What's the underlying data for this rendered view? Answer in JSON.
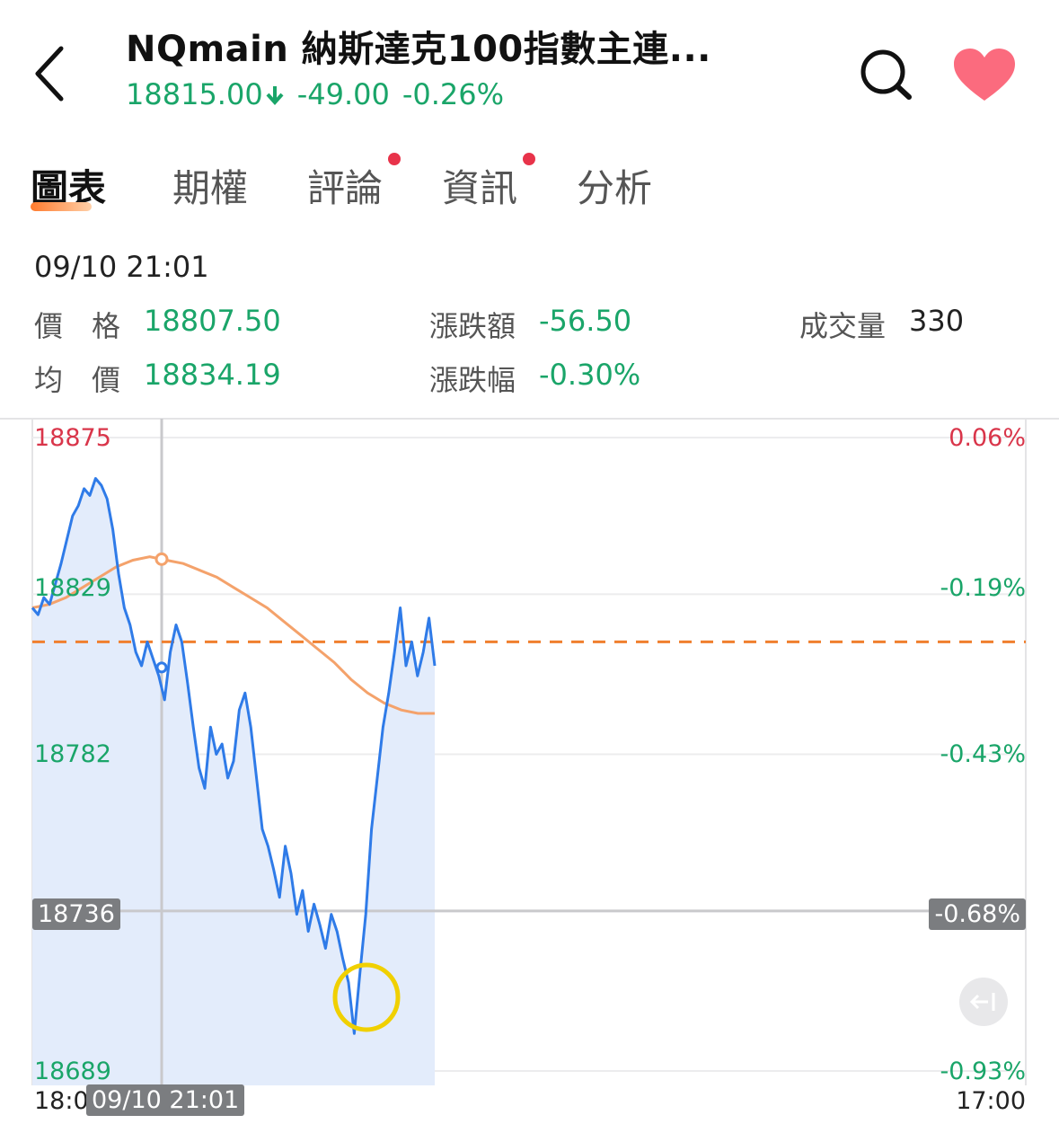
{
  "header": {
    "title": "NQmain  納斯達克100指數主連...",
    "price": "18815.00",
    "change": "-49.00",
    "change_pct": "-0.26%",
    "price_direction": "down",
    "back_icon": "chevron-left-icon",
    "search_icon": "search-icon",
    "favorite_icon": "heart-icon"
  },
  "tabs": [
    {
      "label": "圖表",
      "active": true,
      "has_dot": false
    },
    {
      "label": "期權",
      "active": false,
      "has_dot": false
    },
    {
      "label": "評論",
      "active": false,
      "has_dot": true
    },
    {
      "label": "資訊",
      "active": false,
      "has_dot": true
    },
    {
      "label": "分析",
      "active": false,
      "has_dot": false
    }
  ],
  "info": {
    "time": "09/10 21:01",
    "price_label": "價　格",
    "price_value": "18807.50",
    "avg_label": "均　價",
    "avg_value": "18834.19",
    "change_label": "漲跌額",
    "change_value": "-56.50",
    "change_pct_label": "漲跌幅",
    "change_pct_value": "-0.30%",
    "volume_label": "成交量",
    "volume_value": "330"
  },
  "chart": {
    "y_labels": [
      {
        "text": "18875",
        "color": "red"
      },
      {
        "text": "18829",
        "color": "green"
      },
      {
        "text": "18782",
        "color": "green"
      },
      {
        "text": "18736",
        "color": "tag"
      },
      {
        "text": "18689",
        "color": "green"
      }
    ],
    "pct_labels": [
      {
        "text": "0.06%",
        "color": "red"
      },
      {
        "text": "-0.19%",
        "color": "green"
      },
      {
        "text": "-0.43%",
        "color": "green"
      },
      {
        "text": "-0.68%",
        "color": "tag"
      },
      {
        "text": "-0.93%",
        "color": "green"
      }
    ],
    "x_start": "18:0",
    "x_crosshair_tag": "09/10 21:01",
    "x_end": "17:00",
    "colors": {
      "price_line": "#2f7be8",
      "avg_line": "#f4a26b",
      "ref_line": "#f07f2e",
      "area": "#e3ecfb",
      "highlight": "#f0d000"
    },
    "collapse_icon": "collapse-arrow-icon"
  },
  "chart_data": {
    "type": "line",
    "ylim": [
      18689,
      18875
    ],
    "reference_price": 18815.0,
    "crosshair_time": "09/10 21:01",
    "series": [
      {
        "values": [
          18825,
          18823,
          18828,
          18826,
          18832,
          18838,
          18845,
          18852,
          18855,
          18860,
          18858,
          18863,
          18861,
          18857,
          18848,
          18835,
          18825,
          18820,
          18812,
          18808,
          18815,
          18810,
          18805,
          18798,
          18812,
          18820,
          18815,
          18803,
          18790,
          18778,
          18772,
          18790,
          18782,
          18785,
          18775,
          18780,
          18795,
          18800,
          18790,
          18775,
          18760,
          18755,
          18748,
          18740,
          18755,
          18747,
          18735,
          18742,
          18730,
          18738,
          18732,
          18725,
          18735,
          18730,
          18722,
          18715,
          18700,
          18718,
          18735,
          18760,
          18775,
          18790,
          18800,
          18812,
          18825,
          18808,
          18815,
          18805,
          18812,
          18822,
          18808
        ]
      },
      {
        "values": [
          18825,
          18826,
          18828,
          18831,
          18834,
          18837,
          18839,
          18840,
          18839,
          18838,
          18836,
          18834,
          18831,
          18828,
          18825,
          18821,
          18817,
          18813,
          18809,
          18804,
          18800,
          18797,
          18795,
          18794,
          18794
        ]
      }
    ]
  }
}
